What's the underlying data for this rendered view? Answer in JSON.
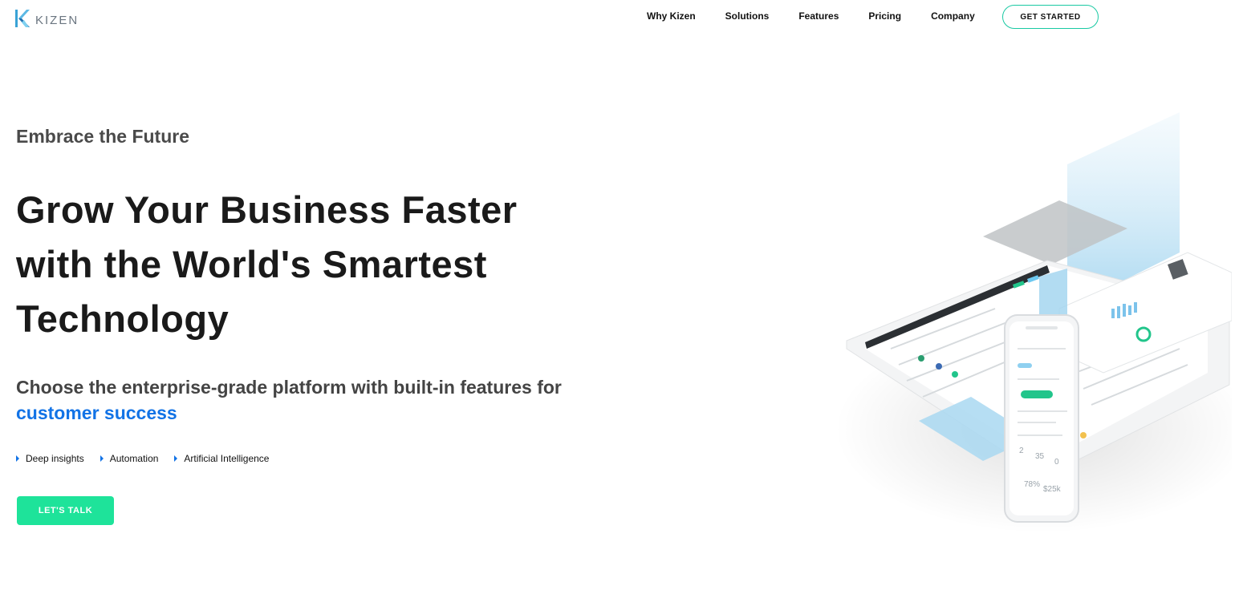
{
  "brand": {
    "name": "KIZEN",
    "accent": "#1273e6",
    "cta_color": "#1ee39a",
    "outline_color": "#19c9a3"
  },
  "nav": {
    "items": [
      {
        "label": "Why Kizen"
      },
      {
        "label": "Solutions"
      },
      {
        "label": "Features"
      },
      {
        "label": "Pricing"
      },
      {
        "label": "Company"
      }
    ],
    "cta_label": "GET STARTED"
  },
  "hero": {
    "eyebrow": "Embrace the Future",
    "headline_lines": [
      "Grow Your Business Faster",
      "with the World's Smartest",
      "Technology"
    ],
    "subhead_main": "Choose the enterprise-grade platform with built-in features for",
    "subhead_accent": "customer success",
    "features": [
      "Deep insights",
      "Automation",
      "Artificial Intelligence"
    ],
    "cta_label": "LET'S TALK",
    "illustration_icon": "dashboard-devices-illustration"
  }
}
